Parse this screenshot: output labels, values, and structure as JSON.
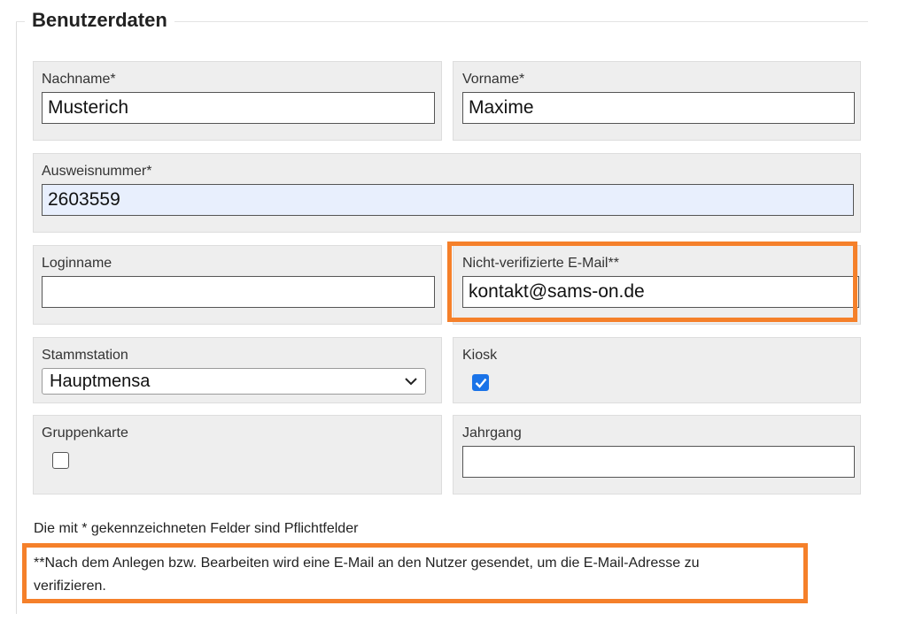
{
  "section": {
    "title": "Benutzerdaten"
  },
  "fields": {
    "lastname": {
      "label": "Nachname*",
      "value": "Musterich"
    },
    "firstname": {
      "label": "Vorname*",
      "value": "Maxime"
    },
    "idnumber": {
      "label": "Ausweisnummer*",
      "value": "2603559"
    },
    "loginname": {
      "label": "Loginname",
      "value": ""
    },
    "email": {
      "label": "Nicht-verifizierte E-Mail**",
      "value": "kontakt@sams-on.de"
    },
    "station": {
      "label": "Stammstation",
      "selected": "Hauptmensa"
    },
    "kiosk": {
      "label": "Kiosk",
      "checked": true
    },
    "groupcard": {
      "label": "Gruppenkarte",
      "checked": false
    },
    "year": {
      "label": "Jahrgang",
      "value": ""
    }
  },
  "notes": {
    "required": "Die mit * gekennzeichneten Felder sind Pflichtfelder",
    "verify_line1": "**Nach dem Anlegen bzw. Bearbeiten wird eine E-Mail an den Nutzer gesendet, um die E-Mail-Adresse zu",
    "verify_line2": "verifizieren."
  },
  "colors": {
    "highlight": "#f5802a",
    "checkbox": "#1a73e8",
    "panel": "#eeeeee",
    "autofill": "#e8effd"
  }
}
